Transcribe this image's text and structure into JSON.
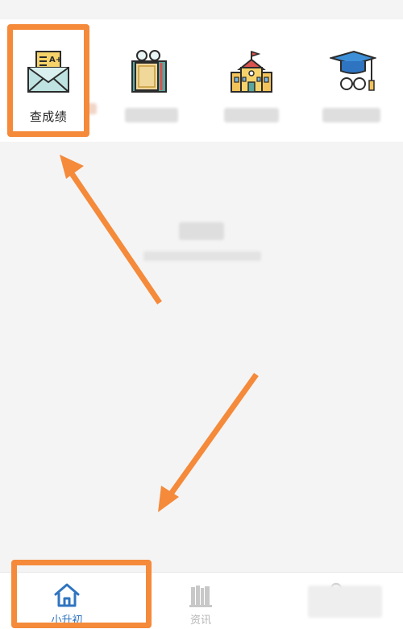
{
  "quick_actions": [
    {
      "label": "查成绩",
      "icon": "report-card-envelope-icon",
      "highlighted": true
    },
    {
      "label": "",
      "icon": "certificate-scroll-icon",
      "highlighted": false
    },
    {
      "label": "",
      "icon": "school-building-icon",
      "highlighted": false
    },
    {
      "label": "",
      "icon": "graduation-cap-icon",
      "highlighted": false
    }
  ],
  "tabbar": {
    "tabs": [
      {
        "label": "小升初",
        "icon": "home-icon",
        "active": true
      },
      {
        "label": "资讯",
        "icon": "books-icon",
        "active": false
      },
      {
        "label": "",
        "icon": "profile-icon",
        "active": false
      }
    ]
  },
  "colors": {
    "annotation": "#f48a3a",
    "active_tab": "#2f74c0",
    "inactive_tab": "#b5b5b5",
    "background": "#f4f4f4"
  }
}
